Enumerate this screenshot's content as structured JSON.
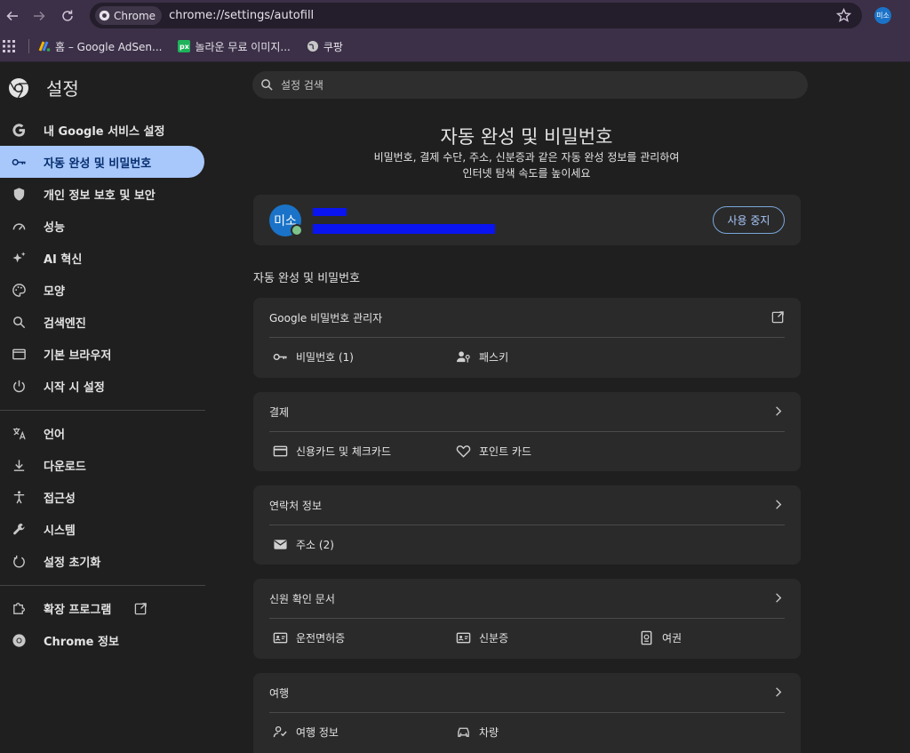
{
  "browser": {
    "chip_label": "Chrome",
    "url": "chrome://settings/autofill",
    "profile_initials": "미소"
  },
  "bookmarks": [
    {
      "label": "홈 – Google AdSen...",
      "color": "#f4b400"
    },
    {
      "label": "놀라운 무료 이미지...",
      "color": "#1eb35a",
      "mark": "px"
    },
    {
      "label": "쿠팡",
      "color": "#c7c7c7"
    }
  ],
  "sidebar": {
    "title": "설정",
    "items": [
      {
        "label": "내 Google 서비스 설정",
        "icon": "google-icon"
      },
      {
        "label": "자동 완성 및 비밀번호",
        "icon": "key-icon"
      },
      {
        "label": "개인 정보 보호 및 보안",
        "icon": "shield-icon"
      },
      {
        "label": "성능",
        "icon": "speedometer-icon"
      },
      {
        "label": "AI 혁신",
        "icon": "sparkle-icon"
      },
      {
        "label": "모양",
        "icon": "palette-icon"
      },
      {
        "label": "검색엔진",
        "icon": "search-icon"
      },
      {
        "label": "기본 브라우저",
        "icon": "browser-window-icon"
      },
      {
        "label": "시작 시 설정",
        "icon": "power-icon"
      },
      {
        "label": "언어",
        "icon": "translate-icon"
      },
      {
        "label": "다운로드",
        "icon": "download-icon"
      },
      {
        "label": "접근성",
        "icon": "accessibility-icon"
      },
      {
        "label": "시스템",
        "icon": "wrench-icon"
      },
      {
        "label": "설정 초기화",
        "icon": "reset-icon"
      },
      {
        "label": "확장 프로그램",
        "icon": "puzzle-icon"
      },
      {
        "label": "Chrome 정보",
        "icon": "chrome-icon"
      }
    ]
  },
  "search": {
    "placeholder": "설정 검색"
  },
  "header": {
    "title": "자동 완성 및 비밀번호",
    "desc_line1": "비밀번호, 결제 수단, 주소, 신분증과 같은 자동 완성 정보를 관리하여",
    "desc_line2": "인터넷 탐색 속도를 높이세요"
  },
  "account": {
    "initials": "미소",
    "stop_label": "사용 중지"
  },
  "section_title": "자동 완성 및 비밀번호",
  "cards": {
    "passwords": {
      "title": "Google 비밀번호 관리자",
      "items": [
        "비밀번호 (1)",
        "패스키"
      ]
    },
    "payment": {
      "title": "결제",
      "items": [
        "신용카드 및 체크카드",
        "포인트 카드"
      ]
    },
    "contact": {
      "title": "연락처 정보",
      "items": [
        "주소 (2)"
      ]
    },
    "identity": {
      "title": "신원 확인 문서",
      "items": [
        "운전면허증",
        "신분증",
        "여권"
      ]
    },
    "travel": {
      "title": "여행",
      "items": [
        "여행 정보",
        "차량"
      ]
    }
  },
  "colors": {
    "accent": "#a8c7fa",
    "background": "#1f1f1f",
    "card": "#2a2a2a",
    "toolbar": "#3b3047"
  }
}
